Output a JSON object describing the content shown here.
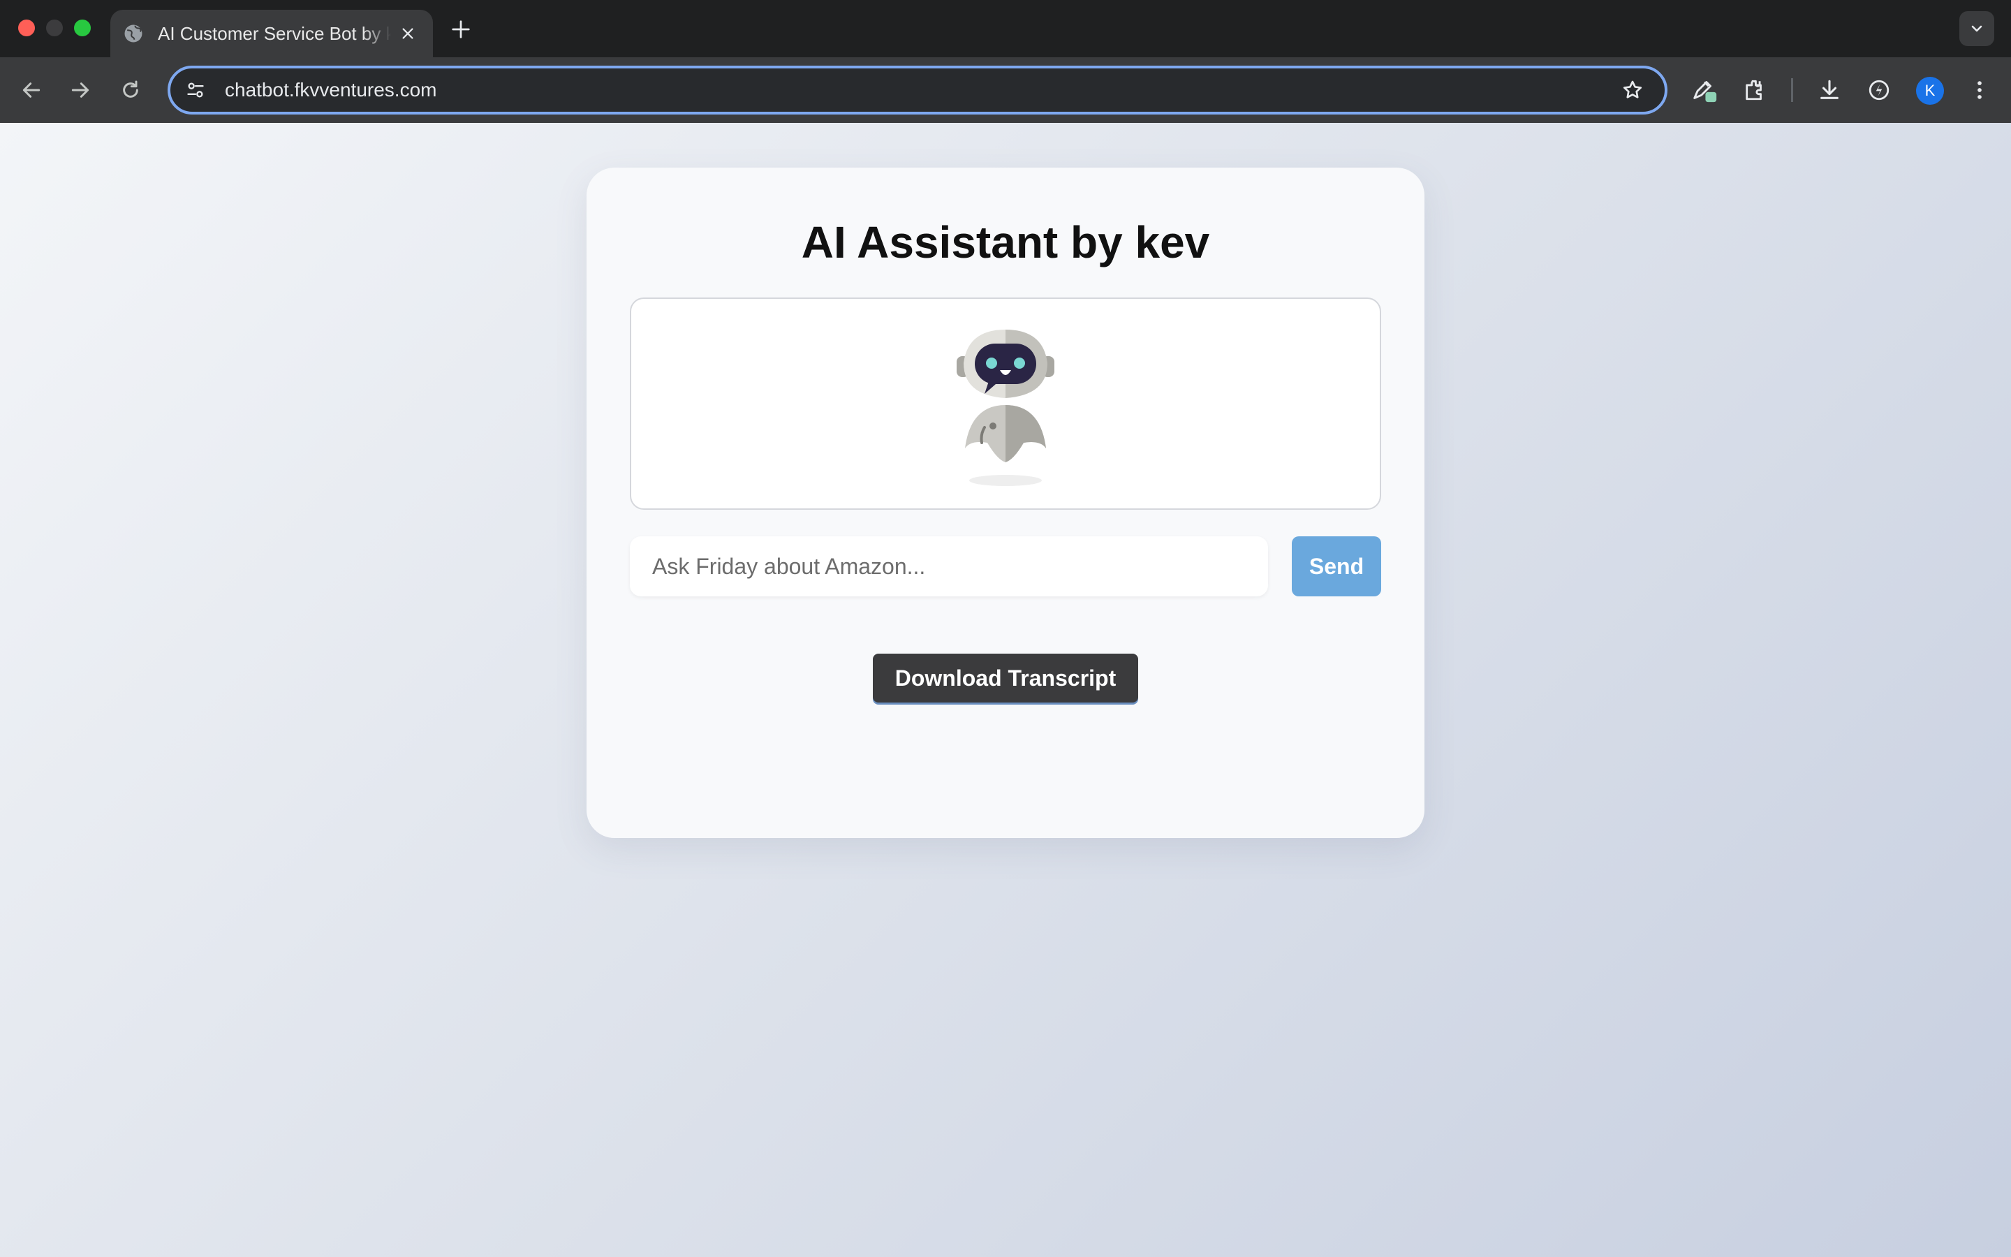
{
  "browser": {
    "tab": {
      "title": "AI Customer Service Bot by kev",
      "favicon": "globe-icon"
    },
    "address_bar": {
      "url": "chatbot.fkvventures.com"
    },
    "profile_initial": "K",
    "icons": [
      "back-icon",
      "forward-icon",
      "reload-icon",
      "site-info-icon",
      "star-icon",
      "pen-extension-icon",
      "extensions-icon",
      "download-icon",
      "performance-icon",
      "more-icon"
    ]
  },
  "app": {
    "title": "AI Assistant by kev",
    "chat": {
      "avatar": "robot-icon"
    },
    "input": {
      "placeholder": "Ask Friday about Amazon...",
      "value": ""
    },
    "send_label": "Send",
    "download_label": "Download Transcript"
  },
  "colors": {
    "send_button": "#6aa8dd",
    "download_button": "#3b3b3d",
    "omnibox_focus": "#7ea8f0"
  }
}
